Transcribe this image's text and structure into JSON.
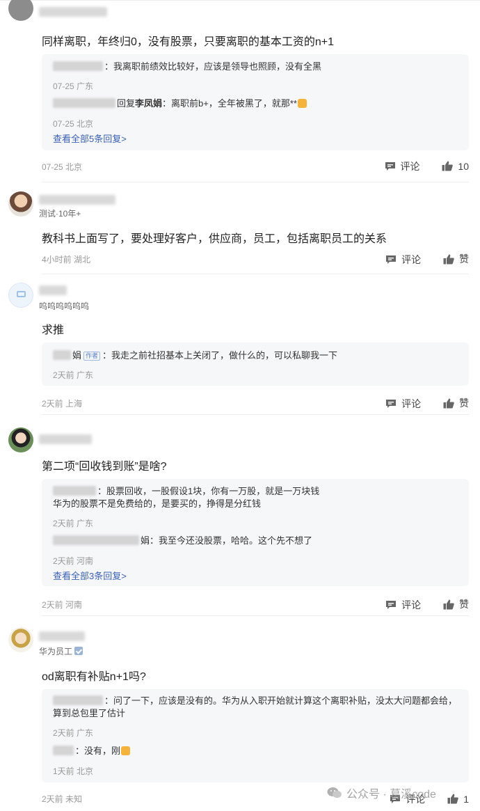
{
  "labels": {
    "comment": "评论",
    "like": "赞"
  },
  "comments": [
    {
      "id": 1,
      "content": "同样离职，年终归0，没有股票，只要离职的基本工资的n+1",
      "replies": [
        {
          "text": "：我离职前绩效比较好，应该是领导也照顾，没有全黑",
          "meta": "07-25 广东"
        },
        {
          "prefix": "回复",
          "to": "李凤娟",
          "text": "：离职前b+，全年被黑了，就那**",
          "meta": "07-25 北京"
        }
      ],
      "more_link": "查看全部5条回复>",
      "meta": "07-25 北京",
      "likes": "10"
    },
    {
      "id": 2,
      "subtitle": "测试·10年+",
      "content": "教科书上面写了，要处理好客户，供应商，员工，包括离职员工的关系",
      "meta": "4小时前 湖北",
      "likes": "赞"
    },
    {
      "id": 3,
      "subtitle": "呜呜呜呜呜呜",
      "content": "求推",
      "replies": [
        {
          "name_tail": "娟",
          "tag": "作者",
          "text": "：我走之前社招基本上关闭了，做什么的，可以私聊我一下",
          "meta": "2天前 广东"
        }
      ],
      "meta": "2天前 上海",
      "likes": "赞"
    },
    {
      "id": 4,
      "content": "第二项“回收钱到账”是啥?",
      "replies": [
        {
          "text": "：股票回收，一股假设1块，你有一万股，就是一万块钱",
          "text2": "华为的股票不是免费给的，是要买的，挣得是分红钱",
          "meta": "2天前 广东"
        },
        {
          "text": "娟：我至今还没股票，哈哈。这个先不想了",
          "meta": "2天前 河南"
        }
      ],
      "more_link": "查看全部3条回复>",
      "meta": "2天前 河南",
      "likes": "赞"
    },
    {
      "id": 5,
      "subtitle": "华为员工",
      "content": "od离职有补贴n+1吗?",
      "replies": [
        {
          "text": "：问了一下，应该是没有的。华为从入职开始就计算这个离职补贴，没太大问题都会给，",
          "text2": "算到总包里了估计",
          "meta": "2天前 广东"
        },
        {
          "text": "：没有，刚",
          "meta": "1天前 北京"
        }
      ],
      "meta": "2天前 未知",
      "likes": "1"
    }
  ],
  "watermark": "公众号 · 葛溪code"
}
